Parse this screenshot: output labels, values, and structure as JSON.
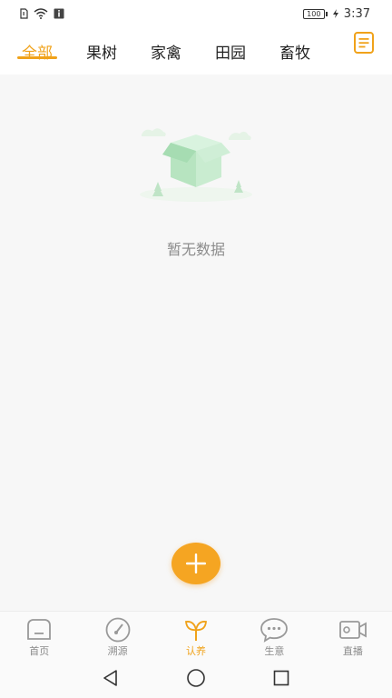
{
  "status_bar": {
    "battery": "100",
    "time": "3:37",
    "icons": [
      "sim-icon",
      "wifi-icon",
      "info-icon",
      "battery-icon",
      "charging-icon"
    ]
  },
  "tabs": [
    {
      "label": "全部",
      "active": true
    },
    {
      "label": "果树",
      "active": false
    },
    {
      "label": "家禽",
      "active": false
    },
    {
      "label": "田园",
      "active": false
    },
    {
      "label": "畜牧",
      "active": false
    }
  ],
  "empty_state": {
    "message": "暂无数据"
  },
  "bottom_nav": [
    {
      "label": "首页",
      "icon": "home-icon",
      "active": false
    },
    {
      "label": "溯源",
      "icon": "gauge-icon",
      "active": false
    },
    {
      "label": "认养",
      "icon": "sprout-icon",
      "active": true
    },
    {
      "label": "生意",
      "icon": "chat-icon",
      "active": false
    },
    {
      "label": "直播",
      "icon": "video-icon",
      "active": false
    }
  ],
  "colors": {
    "accent": "#f0a21a",
    "fab": "#f5a522",
    "inactive_text": "#8a8a8a",
    "background": "#f7f7f7"
  }
}
